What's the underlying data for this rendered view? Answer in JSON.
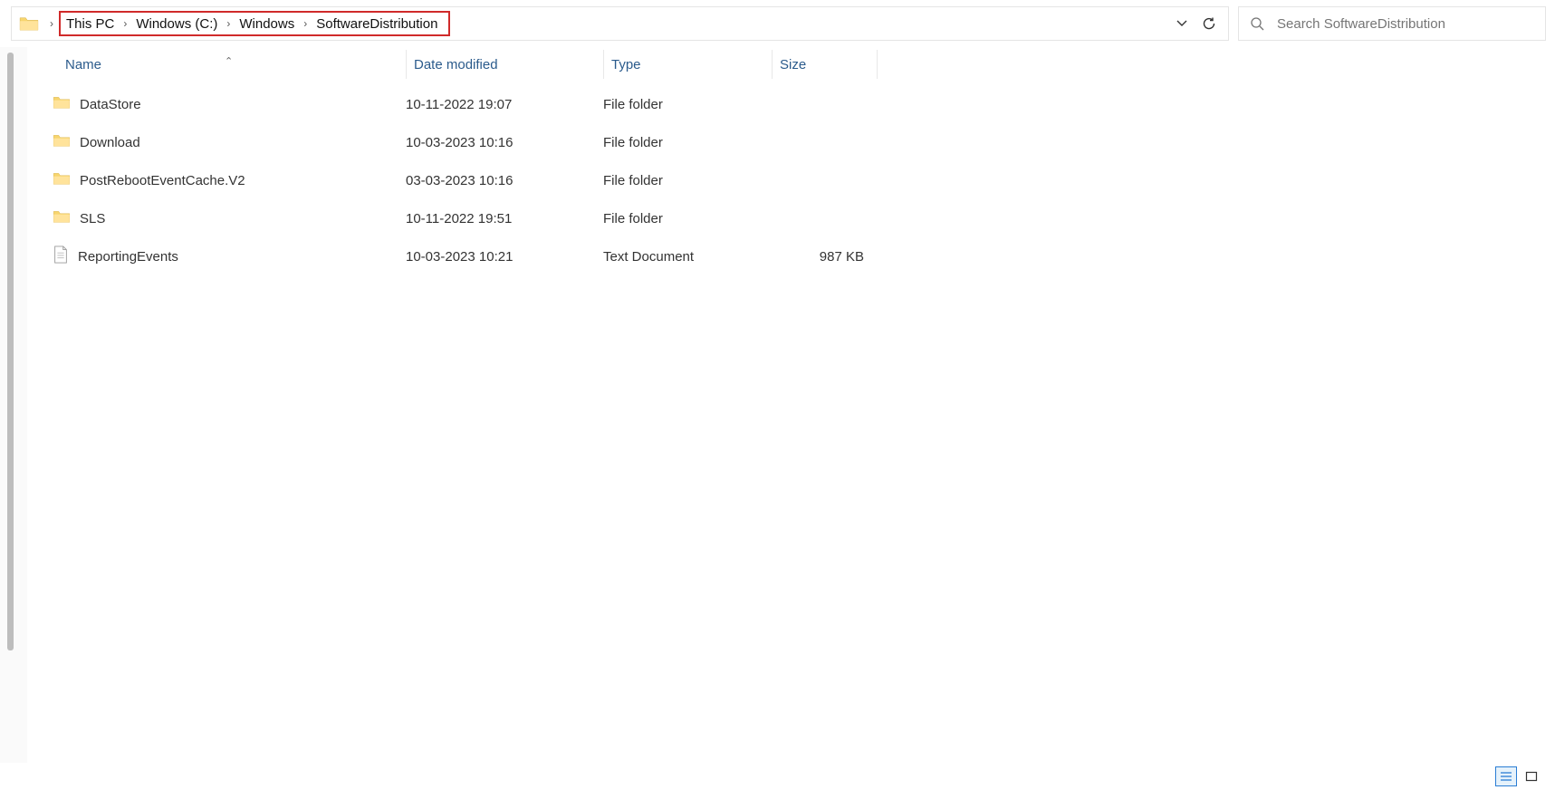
{
  "breadcrumb": {
    "items": [
      "This PC",
      "Windows (C:)",
      "Windows",
      "SoftwareDistribution"
    ]
  },
  "search": {
    "placeholder": "Search SoftwareDistribution"
  },
  "columns": {
    "name": "Name",
    "date": "Date modified",
    "type": "Type",
    "size": "Size"
  },
  "items": [
    {
      "name": "DataStore",
      "date": "10-11-2022 19:07",
      "type": "File folder",
      "size": "",
      "kind": "folder"
    },
    {
      "name": "Download",
      "date": "10-03-2023 10:16",
      "type": "File folder",
      "size": "",
      "kind": "folder"
    },
    {
      "name": "PostRebootEventCache.V2",
      "date": "03-03-2023 10:16",
      "type": "File folder",
      "size": "",
      "kind": "folder"
    },
    {
      "name": "SLS",
      "date": "10-11-2022 19:51",
      "type": "File folder",
      "size": "",
      "kind": "folder"
    },
    {
      "name": "ReportingEvents",
      "date": "10-03-2023 10:21",
      "type": "Text Document",
      "size": "987 KB",
      "kind": "file"
    }
  ]
}
